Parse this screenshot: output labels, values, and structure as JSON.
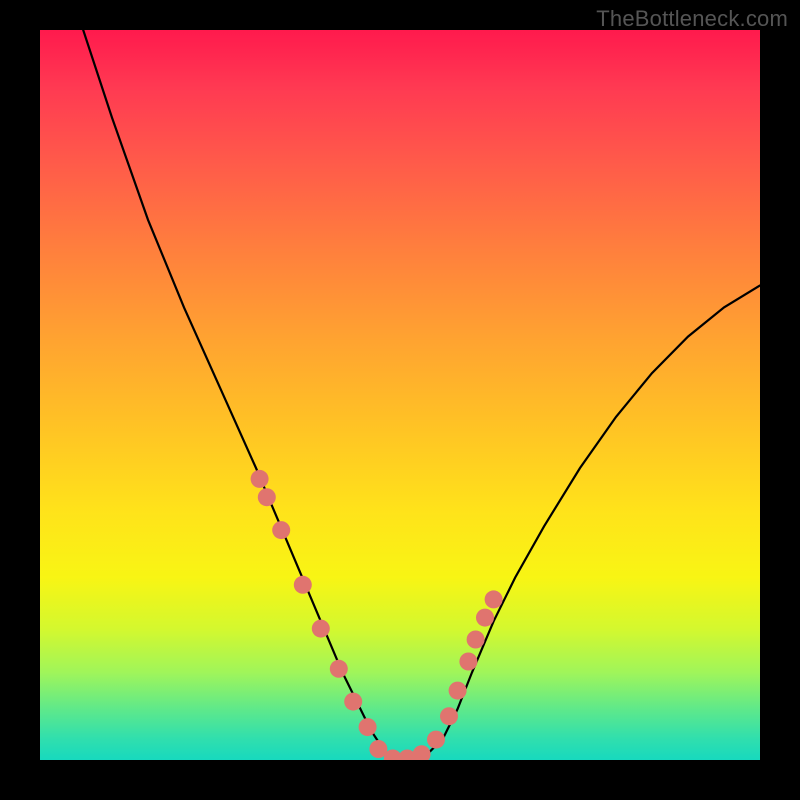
{
  "watermark": "TheBottleneck.com",
  "chart_data": {
    "type": "line",
    "title": "",
    "xlabel": "",
    "ylabel": "",
    "xlim": [
      0,
      100
    ],
    "ylim": [
      0,
      100
    ],
    "grid": false,
    "legend": false,
    "series": [
      {
        "name": "bottleneck-curve",
        "color": "#000000",
        "x": [
          6,
          10,
          15,
          20,
          25,
          30,
          33,
          36,
          39,
          42,
          44,
          46,
          48,
          50,
          52,
          54,
          56,
          58,
          60,
          63,
          66,
          70,
          75,
          80,
          85,
          90,
          95,
          100
        ],
        "y": [
          100,
          88,
          74,
          62,
          51,
          40,
          33,
          26,
          19,
          12,
          8,
          4,
          1,
          0,
          0,
          1,
          3,
          7,
          12,
          19,
          25,
          32,
          40,
          47,
          53,
          58,
          62,
          65
        ]
      }
    ],
    "markers": {
      "name": "highlight-dots",
      "color": "#e0746f",
      "radius_px": 9,
      "x": [
        30.5,
        31.5,
        33.5,
        36.5,
        39.0,
        41.5,
        43.5,
        45.5,
        47.0,
        49.0,
        51.0,
        53.0,
        55.0,
        56.8,
        58.0,
        59.5,
        60.5,
        61.8,
        63.0
      ],
      "y": [
        38.5,
        36.0,
        31.5,
        24.0,
        18.0,
        12.5,
        8.0,
        4.5,
        1.5,
        0.2,
        0.2,
        0.8,
        2.8,
        6.0,
        9.5,
        13.5,
        16.5,
        19.5,
        22.0
      ]
    },
    "background_gradient": {
      "stops": [
        {
          "pos": 0.0,
          "color": "#ff1a4d"
        },
        {
          "pos": 0.3,
          "color": "#ff7f3d"
        },
        {
          "pos": 0.66,
          "color": "#ffe31a"
        },
        {
          "pos": 0.88,
          "color": "#a0f55a"
        },
        {
          "pos": 1.0,
          "color": "#17d9be"
        }
      ]
    }
  }
}
